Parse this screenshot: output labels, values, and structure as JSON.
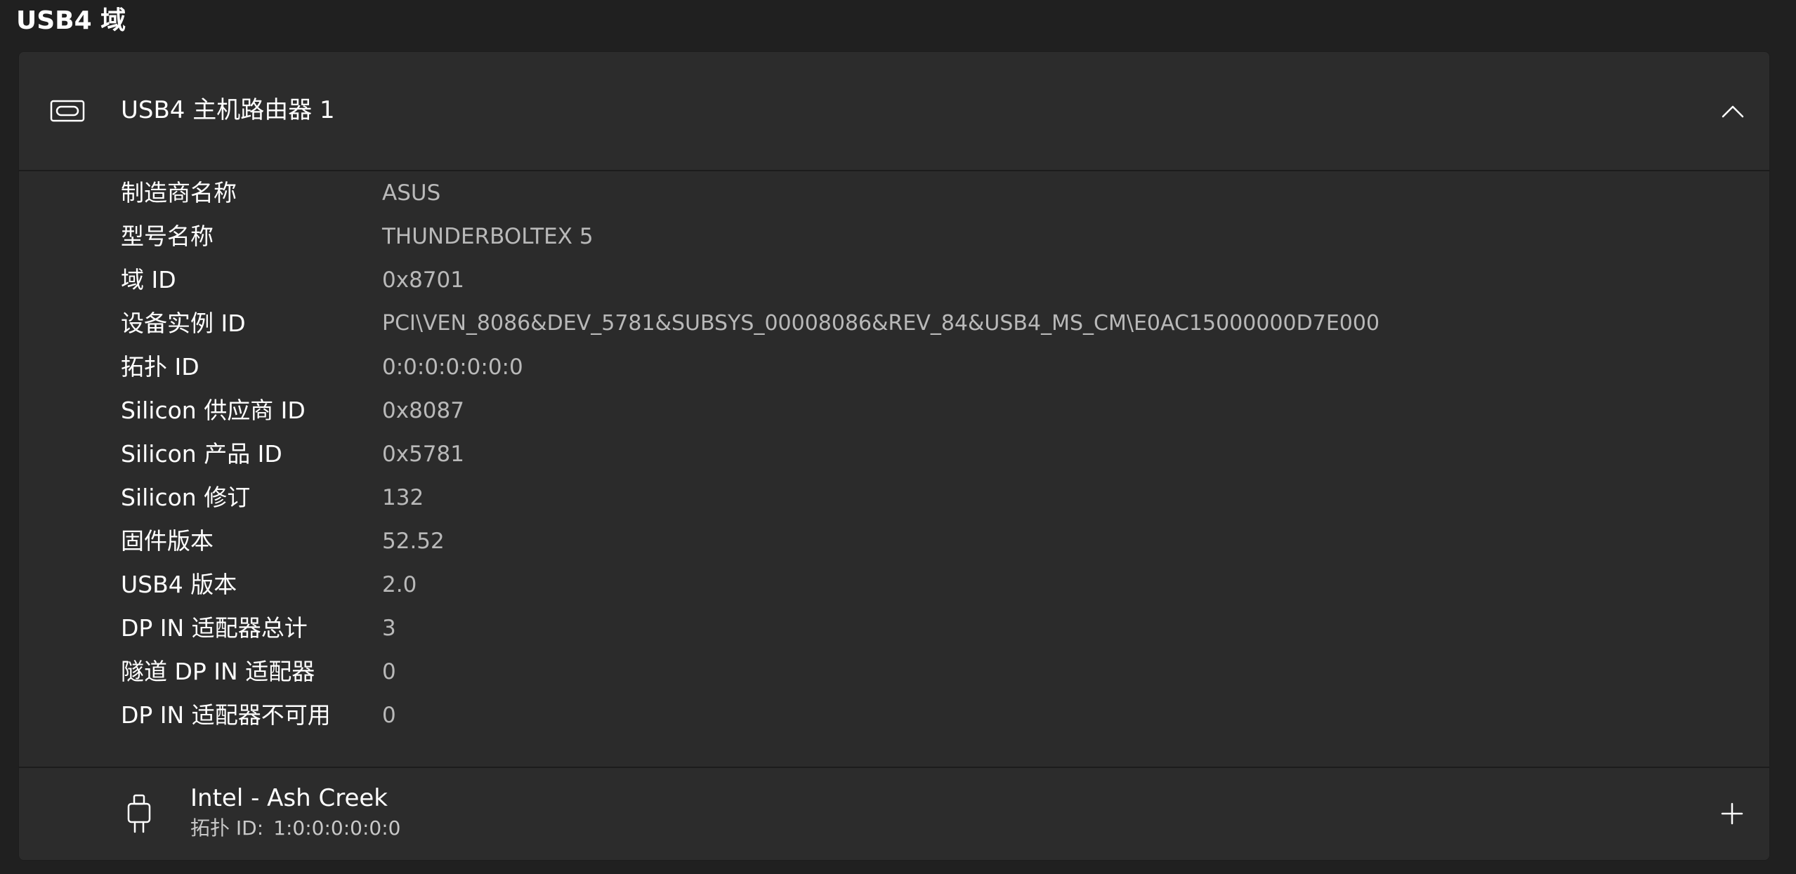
{
  "section": {
    "title": "USB4 域"
  },
  "router": {
    "icon": "usb-c-port-icon",
    "title": "USB4 主机路由器 1",
    "collapse_icon": "chevron-up-icon",
    "properties": [
      {
        "label": "制造商名称",
        "value": "ASUS"
      },
      {
        "label": "型号名称",
        "value": "THUNDERBOLTEX 5"
      },
      {
        "label": "域 ID",
        "value": "0x8701"
      },
      {
        "label": "设备实例 ID",
        "value": "PCI\\VEN_8086&DEV_5781&SUBSYS_00008086&REV_84&USB4_MS_CM\\E0AC15000000D7E000"
      },
      {
        "label": "拓扑 ID",
        "value": "0:0:0:0:0:0:0"
      },
      {
        "label": "Silicon 供应商 ID",
        "value": "0x8087"
      },
      {
        "label": "Silicon 产品 ID",
        "value": "0x5781"
      },
      {
        "label": "Silicon 修订",
        "value": "132"
      },
      {
        "label": "固件版本",
        "value": "52.52"
      },
      {
        "label": "USB4 版本",
        "value": "2.0"
      },
      {
        "label": "DP IN 适配器总计",
        "value": "3"
      },
      {
        "label": "隧道 DP IN 适配器",
        "value": "0"
      },
      {
        "label": "DP IN 适配器不可用",
        "value": "0"
      }
    ]
  },
  "device": {
    "icon": "usb-plug-icon",
    "name": "Intel - Ash Creek",
    "topology_label": "拓扑 ID:",
    "topology_value": "1:0:0:0:0:0:0",
    "expand_icon": "plus-icon"
  },
  "colors": {
    "background": "#202020",
    "card": "#2b2b2b",
    "label_text": "#ffffff",
    "value_text": "#b9b9b9"
  }
}
